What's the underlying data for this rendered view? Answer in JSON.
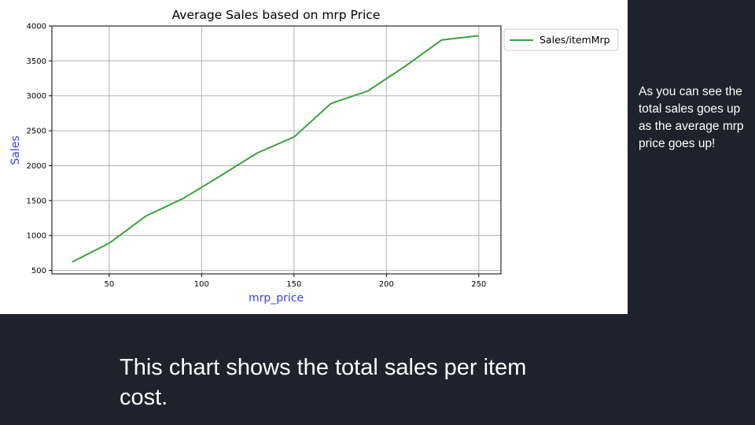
{
  "slide": {
    "side_note": "As you can see the total sales goes up as the average mrp price goes up!",
    "caption": "This chart shows the total sales per item cost."
  },
  "chart_data": {
    "type": "line",
    "title": "Average Sales based on mrp Price",
    "xlabel": "mrp_price",
    "ylabel": "Sales",
    "xlim": [
      19,
      262
    ],
    "ylim": [
      450,
      4000
    ],
    "xticks": [
      50,
      100,
      150,
      200,
      250
    ],
    "yticks": [
      500,
      1000,
      1500,
      2000,
      2500,
      3000,
      3500,
      4000
    ],
    "grid": true,
    "legend_position": "outside-top-right",
    "colors": {
      "line": "#3ca23c",
      "axis_label": "#3d3df0"
    },
    "series": [
      {
        "name": "Sales/itemMrp",
        "x": [
          30,
          50,
          70,
          90,
          110,
          130,
          150,
          170,
          190,
          210,
          230,
          250
        ],
        "y": [
          620,
          890,
          1280,
          1530,
          1850,
          2180,
          2410,
          2890,
          3070,
          3420,
          3800,
          3860
        ]
      }
    ]
  }
}
